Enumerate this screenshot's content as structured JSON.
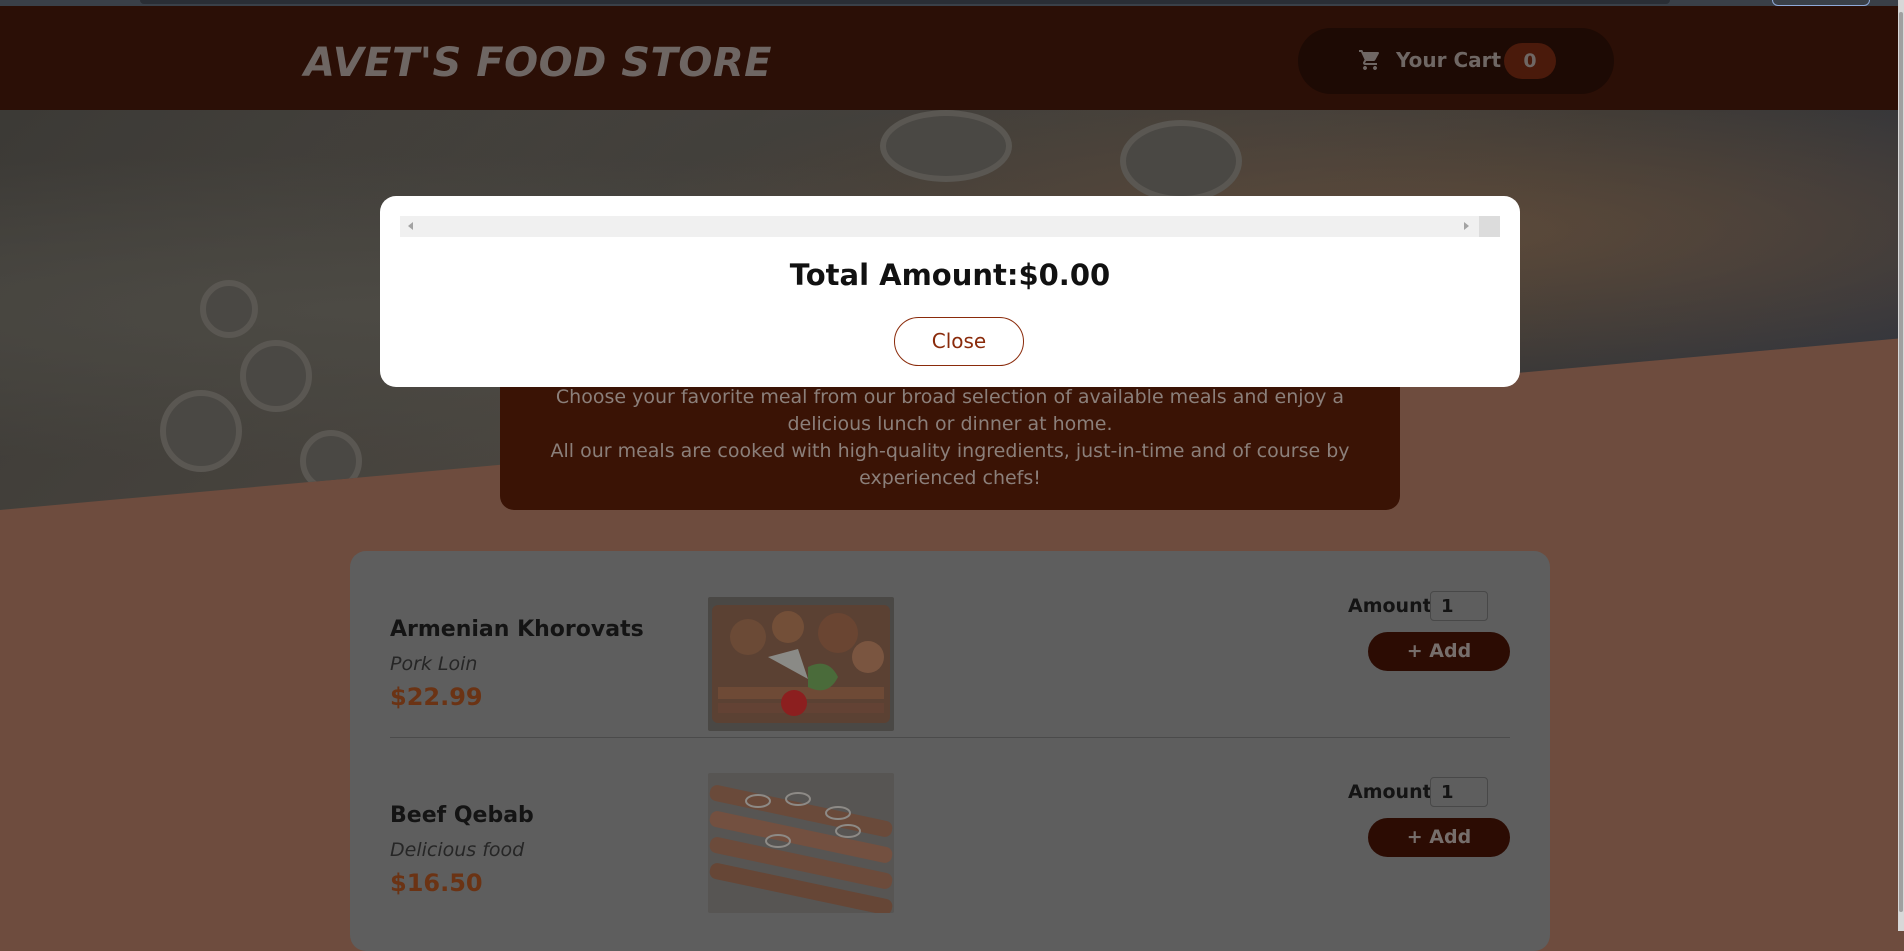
{
  "header": {
    "brand": "AVET'S FOOD STORE",
    "cart_label": "Your Cart",
    "cart_count": "0",
    "cart_icon": "cart-icon"
  },
  "summary": {
    "line1": "Choose your favorite meal from our broad selection of available meals and enjoy a delicious lunch or dinner at home.",
    "line2": "All our meals are cooked with high-quality ingredients, just-in-time and of course by experienced chefs!"
  },
  "meals": [
    {
      "name": "Armenian Khorovats",
      "description": "Pork Loin",
      "price": "$22.99",
      "amount_label": "Amount",
      "amount_value": "1",
      "add_label": "+ Add"
    },
    {
      "name": "Beef Qebab",
      "description": "Delicious food",
      "price": "$16.50",
      "amount_label": "Amount",
      "amount_value": "1",
      "add_label": "+ Add"
    }
  ],
  "modal": {
    "total_text": "Total Amount:$0.00",
    "close_label": "Close"
  },
  "colors": {
    "header_bg": "#2b0f06",
    "accent": "#8a2b0b",
    "price": "#6b3314",
    "overlay_bg": "#6e4c3e"
  }
}
